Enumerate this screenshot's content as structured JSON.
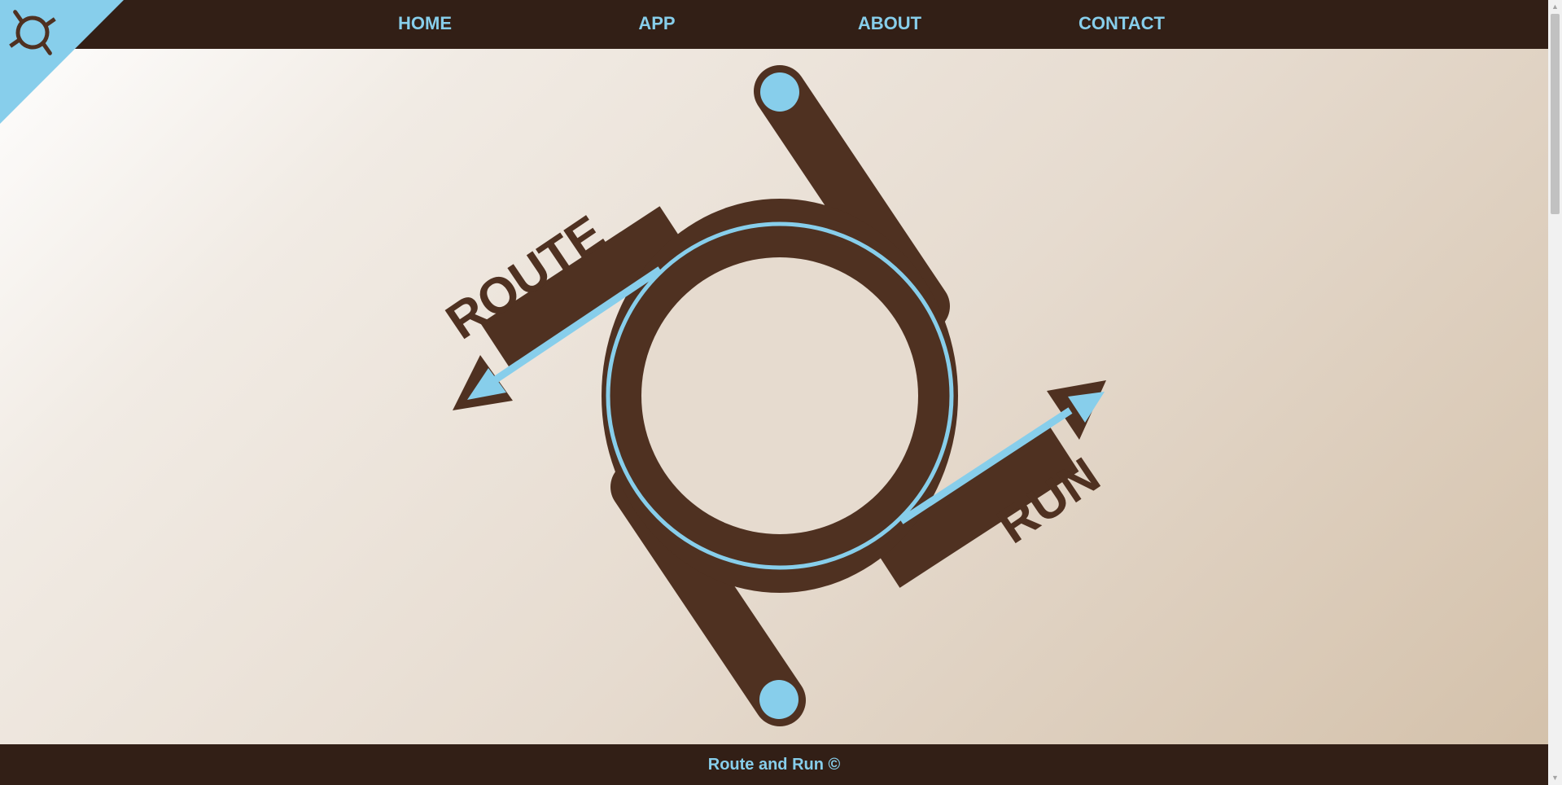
{
  "nav": {
    "items": [
      {
        "label": "HOME"
      },
      {
        "label": "APP"
      },
      {
        "label": "ABOUT"
      },
      {
        "label": "CONTACT"
      }
    ]
  },
  "logo": {
    "icon": "route-and-run-logo-icon"
  },
  "hero": {
    "word_top": "ROUTE",
    "word_bottom": "RUN"
  },
  "footer": {
    "text": "Route and Run ©"
  },
  "colors": {
    "brand_brown": "#4f3121",
    "bar_brown": "#321f16",
    "accent_blue": "#87ceeb"
  }
}
